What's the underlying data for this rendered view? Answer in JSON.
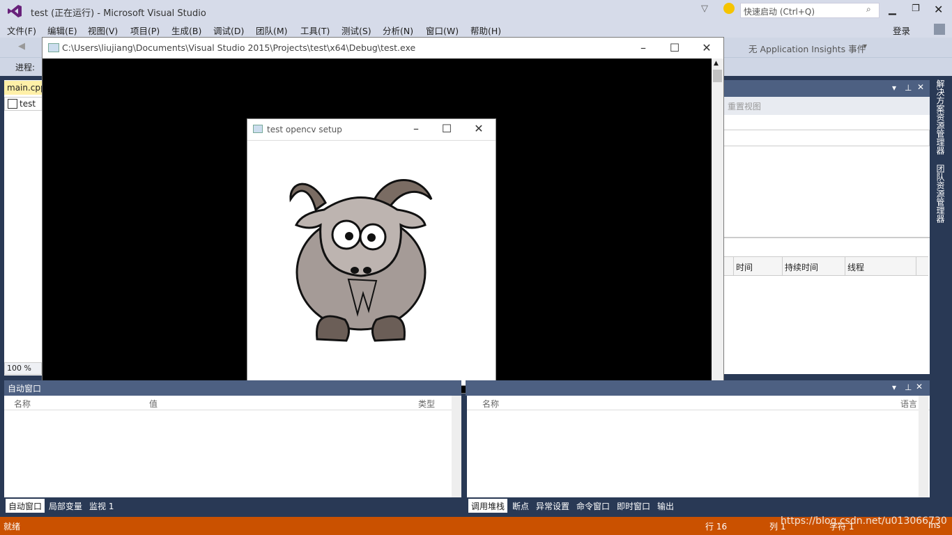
{
  "app": {
    "title": "test (正在运行) - Microsoft Visual Studio",
    "quick_launch_placeholder": "快速启动 (Ctrl+Q)",
    "login": "登录"
  },
  "menu": [
    "文件(F)",
    "编辑(E)",
    "视图(V)",
    "项目(P)",
    "生成(B)",
    "调试(D)",
    "团队(M)",
    "工具(T)",
    "测试(S)",
    "分析(N)",
    "窗口(W)",
    "帮助(H)"
  ],
  "toolbar": {
    "insights": "无 Application Insights 事件",
    "process_label": "进程:"
  },
  "editor": {
    "tab_main": "main.cpp",
    "scope_test": "test",
    "zoom": "100 %"
  },
  "right_panel": {
    "reset_view": "重置视图",
    "columns": [
      "时间",
      "持续时间",
      "线程"
    ],
    "side_tabs": [
      "解决方案资源管理器",
      "团队资源管理器"
    ]
  },
  "console": {
    "path": "C:\\Users\\liujiang\\Documents\\Visual Studio 2015\\Projects\\test\\x64\\Debug\\test.exe"
  },
  "cv_window": {
    "title": "test opencv setup"
  },
  "autos": {
    "header": "自动窗口",
    "columns": [
      "名称",
      "值",
      "类型"
    ],
    "tabs": [
      "自动窗口",
      "局部变量",
      "监视 1"
    ]
  },
  "callstack": {
    "columns": [
      "名称",
      "语言"
    ],
    "tabs": [
      "调用堆栈",
      "断点",
      "异常设置",
      "命令窗口",
      "即时窗口",
      "输出"
    ]
  },
  "status": {
    "ready": "就绪",
    "row": "行 16",
    "col": "列 1",
    "char": "字符 1",
    "ins": "Ins",
    "watermark": "https://blog.csdn.net/u013066730"
  },
  "colors": {
    "status_orange": "#ca5100",
    "panel_header": "#4d6082",
    "chrome": "#d6dbe9"
  }
}
